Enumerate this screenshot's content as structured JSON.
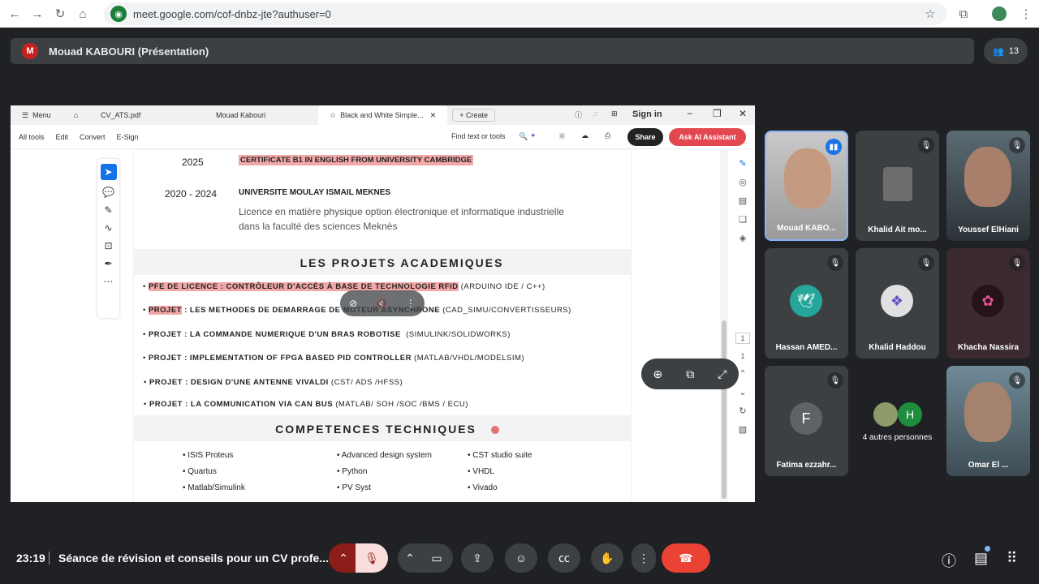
{
  "browser": {
    "url": "meet.google.com/cof-dnbz-jte?authuser=0"
  },
  "presenter_bar": {
    "initial": "M",
    "title": "Mouad KABOURI (Présentation)",
    "participant_count": "13"
  },
  "pdf": {
    "tabs": {
      "menu": "Menu",
      "file1": "CV_ATS.pdf",
      "file2": "Mouad Kabouri",
      "file3": "Black and White Simple...",
      "create": "Create",
      "signin": "Sign in"
    },
    "toolbar": {
      "alltools": "All tools",
      "edit": "Edit",
      "convert": "Convert",
      "esign": "E-Sign",
      "find": "Find text or tools",
      "share": "Share",
      "ai": "Ask AI Assistant"
    },
    "content": {
      "year1": "2025",
      "cert": "CERTIFICATE B1 IN ENGLISH FROM UNIVERSITY CAMBRIDGE",
      "year2": "2020 - 2024",
      "uni": "UNIVERSITE MOULAY ISMAIL MEKNES",
      "lic1": "Licence en matière physique option électronique et informatique industrielle",
      "lic2": "dans la faculté des sciences Meknès",
      "proj_title": "LES PROJETS ACADEMIQUES",
      "p1_hl": "PFE DE LICENCE : CONTRÔLEUR D'ACCÈS À BASE DE TECHNOLOGIE RFID",
      "p1_tools": "(ARDUINO IDE / C++)",
      "p2_hl": "PROJET",
      "p2": ": LES METHODES DE DEMARRAGE DE MOTEUR ASYNCHRONE",
      "p2_tools": "(CAD_SIMU/CONVERTISSEURS)",
      "p3": "PROJET : LA COMMANDE NUMERIQUE D'UN BRAS ROBOTISE",
      "p3_tools": "(SIMULINK/SOLIDWORKS)",
      "p4": "PROJET : IMPLEMENTATION OF FPGA BASED PID CONTROLLER",
      "p4_tools": "(MATLAB/VHDL/MODELSIM)",
      "p5": "PROJET : DESIGN D'UNE ANTENNE VIVALDI",
      "p5_tools": "(CST/ ADS /HFSS)",
      "p6": "PROJET : LA COMMUNICATION VIA CAN BUS",
      "p6_tools": "(MATLAB/ SOH /SOC /BMS / ECU)",
      "comp_title": "COMPETENCES TECHNIQUES",
      "skills": [
        [
          "ISIS Proteus",
          "Quartus",
          "Matlab/Simulink"
        ],
        [
          "Advanced design system",
          "Python",
          "PV Syst"
        ],
        [
          "CST studio suite",
          "VHDL",
          "Vivado"
        ]
      ]
    },
    "page_nums": [
      "1",
      "1"
    ]
  },
  "participants": [
    {
      "name": "Mouad KABO...",
      "kind": "video"
    },
    {
      "name": "Khalid Ait mo...",
      "kind": "photo"
    },
    {
      "name": "Youssef ElHiani",
      "kind": "video"
    },
    {
      "name": "Hassan AMED...",
      "kind": "avatar",
      "color": "#26a69a"
    },
    {
      "name": "Khalid Haddou",
      "kind": "avatar",
      "color": "#e0e0e0"
    },
    {
      "name": "Khacha Nassira",
      "kind": "avatar",
      "color": "#3b2a2f"
    },
    {
      "name": "Fatima ezzahr...",
      "initial": "F",
      "kind": "letter",
      "color": "#5f6368"
    },
    {
      "name": "4 autres personnes",
      "initial": "H",
      "kind": "others",
      "color": "#1e8e3e"
    },
    {
      "name": "Omar El ...",
      "kind": "video"
    }
  ],
  "bottom": {
    "time": "23:19",
    "meeting": "Séance de révision et conseils pour un CV profe..."
  },
  "colors": {
    "highlight": "#f3a8a8",
    "end_call": "#ea4335",
    "meet_bg": "#202124"
  }
}
